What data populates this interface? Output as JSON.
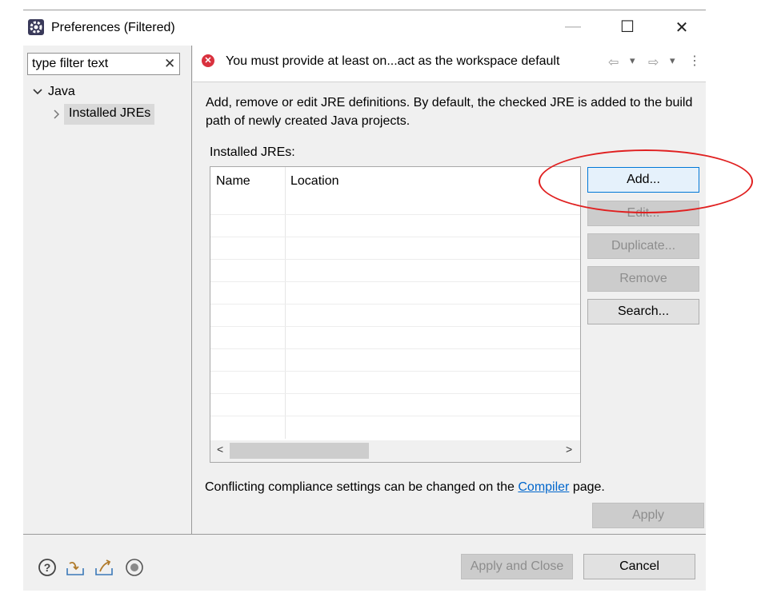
{
  "window": {
    "title": "Preferences (Filtered)",
    "controls": {
      "minimize": "—",
      "maximize": "☐",
      "close": "✕"
    }
  },
  "sidebar": {
    "filter_placeholder": "type filter text",
    "clear_icon": "✕",
    "tree": [
      {
        "label": "Java",
        "expanded": true
      },
      {
        "label": "Installed JREs",
        "selected": true
      }
    ]
  },
  "header": {
    "error_message": "You must provide at least on...act as the workspace default",
    "nav": {
      "back": "⇦",
      "forward": "⇨",
      "dropdown": "▾",
      "menu": "⋮"
    }
  },
  "main": {
    "description": "Add, remove or edit JRE definitions. By default, the checked JRE is added to the build path of newly created Java projects.",
    "installed_label": "Installed JREs:",
    "table": {
      "columns": [
        "Name",
        "Location"
      ],
      "rows": []
    },
    "buttons": {
      "add": "Add...",
      "edit": "Edit...",
      "duplicate": "Duplicate...",
      "remove": "Remove",
      "search": "Search..."
    },
    "compliance_prefix": "Conflicting compliance settings can be changed on the ",
    "compliance_link": "Compiler",
    "compliance_suffix": " page.",
    "apply": "Apply"
  },
  "footer": {
    "apply_close": "Apply and Close",
    "cancel": "Cancel"
  },
  "colors": {
    "error": "#d9313e",
    "link": "#0066cc",
    "highlight": "#e02020"
  }
}
